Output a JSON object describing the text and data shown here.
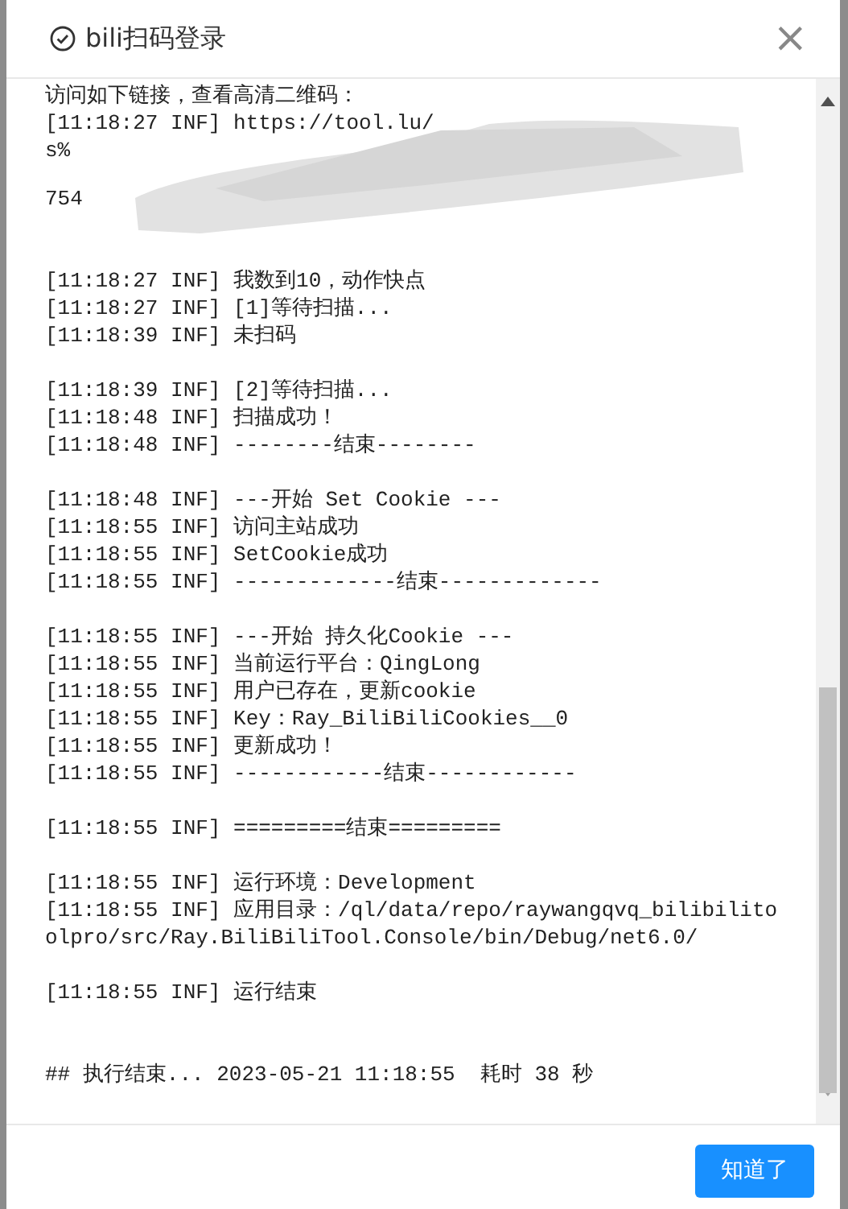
{
  "dialog": {
    "title": "bili扫码登录",
    "close": "×"
  },
  "log": {
    "top_lines": [
      "访问如下链接，查看高清二维码：",
      "[11:18:27 INF] https://tool.lu/",
      "s%",
      "754"
    ],
    "blocks": [
      [
        "[11:18:27 INF] 我数到10，动作快点",
        "[11:18:27 INF] [1]等待扫描...",
        "[11:18:39 INF] 未扫码"
      ],
      [
        "[11:18:39 INF] [2]等待扫描...",
        "[11:18:48 INF] 扫描成功！",
        "[11:18:48 INF] --------结束--------"
      ],
      [
        "[11:18:48 INF] ---开始 Set Cookie ---",
        "[11:18:55 INF] 访问主站成功",
        "[11:18:55 INF] SetCookie成功",
        "[11:18:55 INF] -------------结束-------------"
      ],
      [
        "[11:18:55 INF] ---开始 持久化Cookie ---",
        "[11:18:55 INF] 当前运行平台：QingLong",
        "[11:18:55 INF] 用户已存在，更新cookie",
        "[11:18:55 INF] Key：Ray_BiliBiliCookies__0",
        "[11:18:55 INF] 更新成功！",
        "[11:18:55 INF] ------------结束------------"
      ],
      [
        "[11:18:55 INF] =========结束========="
      ],
      [
        "[11:18:55 INF] 运行环境：Development",
        "[11:18:55 INF] 应用目录：/ql/data/repo/raywangqvq_bilibilitoolpro/src/Ray.BiliBiliTool.Console/bin/Debug/net6.0/"
      ],
      [
        "[11:18:55 INF] 运行结束"
      ]
    ],
    "summary": "## 执行结束... 2023-05-21 11:18:55  耗时 38 秒"
  },
  "buttons": [
    "知道了"
  ]
}
